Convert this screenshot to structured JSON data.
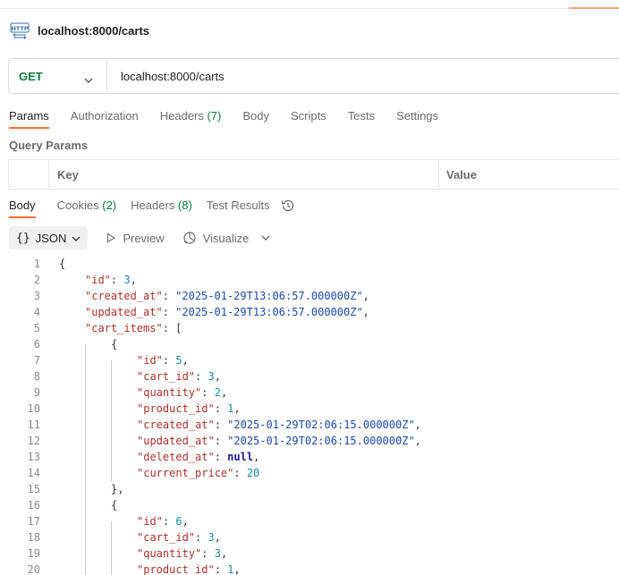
{
  "request": {
    "title": "localhost:8000/carts",
    "method": "GET",
    "url": "localhost:8000/carts"
  },
  "request_tabs": [
    {
      "label": "Params",
      "count": ""
    },
    {
      "label": "Authorization",
      "count": ""
    },
    {
      "label": "Headers",
      "count": "(7)"
    },
    {
      "label": "Body",
      "count": ""
    },
    {
      "label": "Scripts",
      "count": ""
    },
    {
      "label": "Tests",
      "count": ""
    },
    {
      "label": "Settings",
      "count": ""
    }
  ],
  "query_params": {
    "label": "Query Params",
    "columns": [
      "Key",
      "Value"
    ]
  },
  "response_tabs": [
    {
      "label": "Body",
      "count": ""
    },
    {
      "label": "Cookies",
      "count": "(2)"
    },
    {
      "label": "Headers",
      "count": "(8)"
    },
    {
      "label": "Test Results",
      "count": ""
    }
  ],
  "response_toolbar": {
    "format": "JSON",
    "preview": "Preview",
    "visualize": "Visualize"
  },
  "code_lines": [
    {
      "n": "1",
      "tokens": [
        [
          "p",
          "{"
        ]
      ]
    },
    {
      "n": "2",
      "tokens": [
        [
          "k",
          "\"id\""
        ],
        [
          "p",
          ": "
        ],
        [
          "n",
          "3"
        ],
        [
          "p",
          ","
        ]
      ]
    },
    {
      "n": "3",
      "tokens": [
        [
          "k",
          "\"created_at\""
        ],
        [
          "p",
          ": "
        ],
        [
          "s",
          "\"2025-01-29T13:06:57.000000Z\""
        ],
        [
          "p",
          ","
        ]
      ]
    },
    {
      "n": "4",
      "tokens": [
        [
          "k",
          "\"updated_at\""
        ],
        [
          "p",
          ": "
        ],
        [
          "s",
          "\"2025-01-29T13:06:57.000000Z\""
        ],
        [
          "p",
          ","
        ]
      ]
    },
    {
      "n": "5",
      "tokens": [
        [
          "k",
          "\"cart_items\""
        ],
        [
          "p",
          ": ["
        ]
      ]
    },
    {
      "n": "6",
      "tokens": [
        [
          "p",
          "{"
        ]
      ]
    },
    {
      "n": "7",
      "tokens": [
        [
          "k",
          "\"id\""
        ],
        [
          "p",
          ": "
        ],
        [
          "n",
          "5"
        ],
        [
          "p",
          ","
        ]
      ]
    },
    {
      "n": "8",
      "tokens": [
        [
          "k",
          "\"cart_id\""
        ],
        [
          "p",
          ": "
        ],
        [
          "n",
          "3"
        ],
        [
          "p",
          ","
        ]
      ]
    },
    {
      "n": "9",
      "tokens": [
        [
          "k",
          "\"quantity\""
        ],
        [
          "p",
          ": "
        ],
        [
          "n",
          "2"
        ],
        [
          "p",
          ","
        ]
      ]
    },
    {
      "n": "10",
      "tokens": [
        [
          "k",
          "\"product_id\""
        ],
        [
          "p",
          ": "
        ],
        [
          "n",
          "1"
        ],
        [
          "p",
          ","
        ]
      ]
    },
    {
      "n": "11",
      "tokens": [
        [
          "k",
          "\"created_at\""
        ],
        [
          "p",
          ": "
        ],
        [
          "s",
          "\"2025-01-29T02:06:15.000000Z\""
        ],
        [
          "p",
          ","
        ]
      ]
    },
    {
      "n": "12",
      "tokens": [
        [
          "k",
          "\"updated_at\""
        ],
        [
          "p",
          ": "
        ],
        [
          "s",
          "\"2025-01-29T02:06:15.000000Z\""
        ],
        [
          "p",
          ","
        ]
      ]
    },
    {
      "n": "13",
      "tokens": [
        [
          "k",
          "\"deleted_at\""
        ],
        [
          "p",
          ": "
        ],
        [
          "kw",
          "null"
        ],
        [
          "p",
          ","
        ]
      ]
    },
    {
      "n": "14",
      "tokens": [
        [
          "k",
          "\"current_price\""
        ],
        [
          "p",
          ": "
        ],
        [
          "n",
          "20"
        ]
      ]
    },
    {
      "n": "15",
      "tokens": [
        [
          "p",
          "},"
        ]
      ]
    },
    {
      "n": "16",
      "tokens": [
        [
          "p",
          "{"
        ]
      ]
    },
    {
      "n": "17",
      "tokens": [
        [
          "k",
          "\"id\""
        ],
        [
          "p",
          ": "
        ],
        [
          "n",
          "6"
        ],
        [
          "p",
          ","
        ]
      ]
    },
    {
      "n": "18",
      "tokens": [
        [
          "k",
          "\"cart_id\""
        ],
        [
          "p",
          ": "
        ],
        [
          "n",
          "3"
        ],
        [
          "p",
          ","
        ]
      ]
    },
    {
      "n": "19",
      "tokens": [
        [
          "k",
          "\"quantity\""
        ],
        [
          "p",
          ": "
        ],
        [
          "n",
          "3"
        ],
        [
          "p",
          ","
        ]
      ]
    },
    {
      "n": "20",
      "tokens": [
        [
          "k",
          "\"product_id\""
        ],
        [
          "p",
          ": "
        ],
        [
          "n",
          "1"
        ],
        [
          "p",
          ","
        ]
      ]
    }
  ],
  "colors": {
    "accent": "#ff6c37",
    "method_get": "#0b7a3b",
    "json_key": "#a8312b",
    "json_string": "#1a49a8",
    "json_number": "#1a8a9a"
  },
  "icons": {
    "request_type": "http-icon",
    "method_dropdown": "chevron-down-icon",
    "history": "history-icon",
    "preview": "play-icon",
    "visualize": "visualize-icon"
  }
}
